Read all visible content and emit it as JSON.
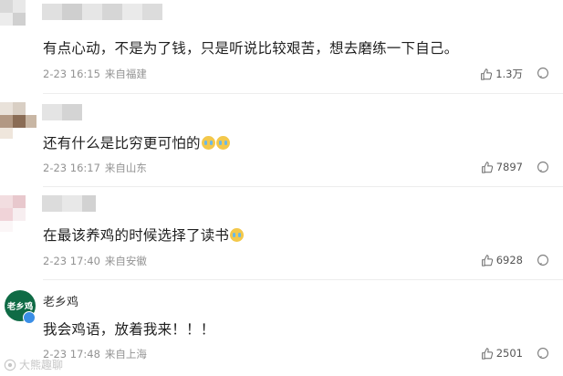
{
  "comments": [
    {
      "username": "",
      "text": "有点心动，不是为了钱，只是听说比较艰苦，想去磨练一下自己。",
      "date": "2-23 16:15",
      "location": "来自福建",
      "likes": "1.3万"
    },
    {
      "username": "",
      "text": "还有什么是比穷更可怕的",
      "emoji_icons": [
        "crying-face-icon",
        "crying-face-icon"
      ],
      "date": "2-23 16:17",
      "location": "来自山东",
      "likes": "7897"
    },
    {
      "username": "",
      "text": "在最该养鸡的时候选择了读书",
      "emoji_icons": [
        "crying-face-icon"
      ],
      "date": "2-23 17:40",
      "location": "来自安徽",
      "likes": "6928"
    },
    {
      "username": "老乡鸡",
      "avatar_text": "老乡鸡",
      "text": "我会鸡语，放着我来！！！",
      "date": "2-23 17:48",
      "location": "来自上海",
      "likes": "2501"
    }
  ],
  "watermark": "大熊趣聊",
  "colors": {
    "accent_avatar": "#0f6b45",
    "verified_badge": "#3a8ee6",
    "meta_text": "#939393"
  }
}
